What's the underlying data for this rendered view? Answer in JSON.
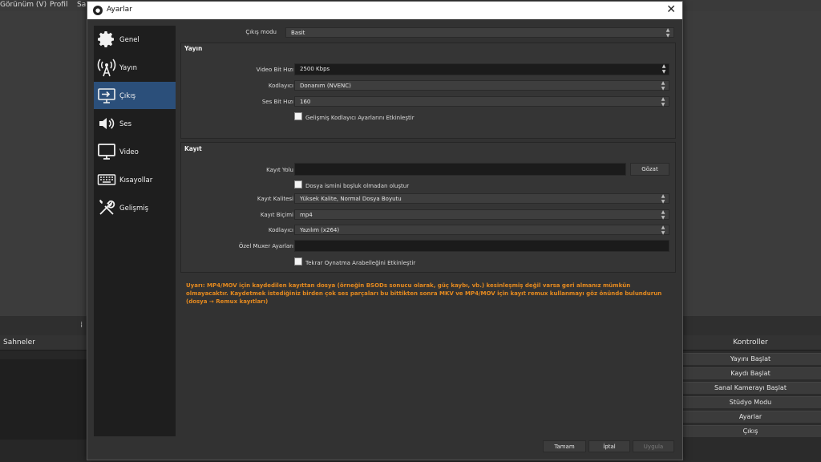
{
  "main_window": {
    "menu": [
      "Görünüm (V)",
      "Profil",
      "Sah"
    ],
    "docks": {
      "scenes_title": "Sahneler",
      "controls_title": "Kontroller",
      "controls_buttons": [
        "Yayını Başlat",
        "Kaydı Başlat",
        "Sanal Kamerayı Başlat",
        "Stüdyo Modu",
        "Ayarlar",
        "Çıkış"
      ]
    }
  },
  "dialog": {
    "title": "Ayarlar",
    "sidebar": [
      {
        "label": "Genel",
        "icon": "gear-icon"
      },
      {
        "label": "Yayın",
        "icon": "broadcast-icon"
      },
      {
        "label": "Çıkış",
        "icon": "output-icon",
        "active": true
      },
      {
        "label": "Ses",
        "icon": "speaker-icon"
      },
      {
        "label": "Video",
        "icon": "monitor-icon"
      },
      {
        "label": "Kısayollar",
        "icon": "keyboard-icon"
      },
      {
        "label": "Gelişmiş",
        "icon": "tools-icon"
      }
    ],
    "output_mode": {
      "label": "Çıkış modu",
      "value": "Basit"
    },
    "streaming": {
      "title": "Yayın",
      "video_bitrate": {
        "label": "Video Bit Hızı",
        "value": "2500 Kbps"
      },
      "encoder": {
        "label": "Kodlayıcı",
        "value": "Donanım (NVENC)"
      },
      "audio_bitrate": {
        "label": "Ses Bit Hızı",
        "value": "160"
      },
      "advanced_check": {
        "label": "Gelişmiş Kodlayıcı Ayarlarını Etkinleştir",
        "checked": false
      }
    },
    "recording": {
      "title": "Kayıt",
      "path": {
        "label": "Kayıt Yolu",
        "value": "",
        "browse": "Gözat"
      },
      "no_space_check": {
        "label": "Dosya ismini boşluk olmadan oluştur",
        "checked": false
      },
      "quality": {
        "label": "Kayıt Kalitesi",
        "value": "Yüksek Kalite, Normal Dosya Boyutu"
      },
      "format": {
        "label": "Kayıt Biçimi",
        "value": "mp4"
      },
      "encoder": {
        "label": "Kodlayıcı",
        "value": "Yazılım (x264)"
      },
      "muxer": {
        "label": "Özel Muxer Ayarları",
        "value": ""
      },
      "replay_check": {
        "label": "Tekrar Oynatma Arabelleğini Etkinleştir",
        "checked": false
      }
    },
    "warning": "Uyarı: MP4/MOV için kaydedilen kayıttan dosya (örneğin BSODs sonucu olarak, güç kaybı, vb.) kesinleşmiş değil varsa geri almanız mümkün olmayacaktır. Kaydetmek istediğiniz birden çok ses parçaları bu bittikten sonra MKV ve MP4/MOV için kayıt remux kullanmayı göz önünde bulundurun (dosya → Remux kayıtları)",
    "buttons": {
      "ok": "Tamam",
      "cancel": "İptal",
      "apply": "Uygula"
    }
  }
}
